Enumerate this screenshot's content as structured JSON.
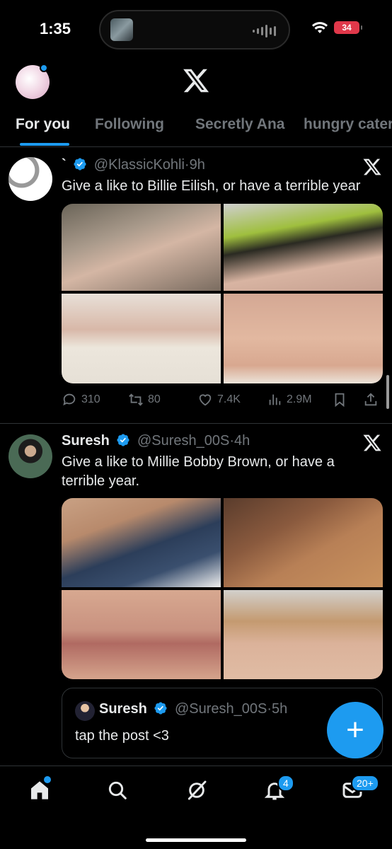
{
  "status_bar": {
    "time": "1:35",
    "battery": "34"
  },
  "tabs": [
    {
      "label": "For you",
      "active": true
    },
    {
      "label": "Following",
      "active": false
    },
    {
      "label": "Secretly Ana",
      "active": false
    },
    {
      "label": "hungry cater",
      "active": false
    }
  ],
  "posts": [
    {
      "name": "`",
      "handle": "@KlassicKohli",
      "time": "9h",
      "text": "Give a like to Billie Eilish, or have a terrible year",
      "replies": "310",
      "reposts": "80",
      "likes": "7.4K",
      "views": "2.9M"
    },
    {
      "name": "Suresh",
      "handle": "@Suresh_00S",
      "time": "4h",
      "text": "Give a like to Millie Bobby Brown, or have a terrible year.",
      "quote": {
        "name": "Suresh",
        "handle": "@Suresh_00S",
        "time": "5h",
        "text": "tap the post <3"
      }
    }
  ],
  "fab": {
    "label": "+"
  },
  "nav": {
    "notifications_badge": "4",
    "messages_badge": "20+"
  },
  "colors": {
    "accent": "#1d9bf0",
    "background": "#000000",
    "muted": "#71767b"
  }
}
